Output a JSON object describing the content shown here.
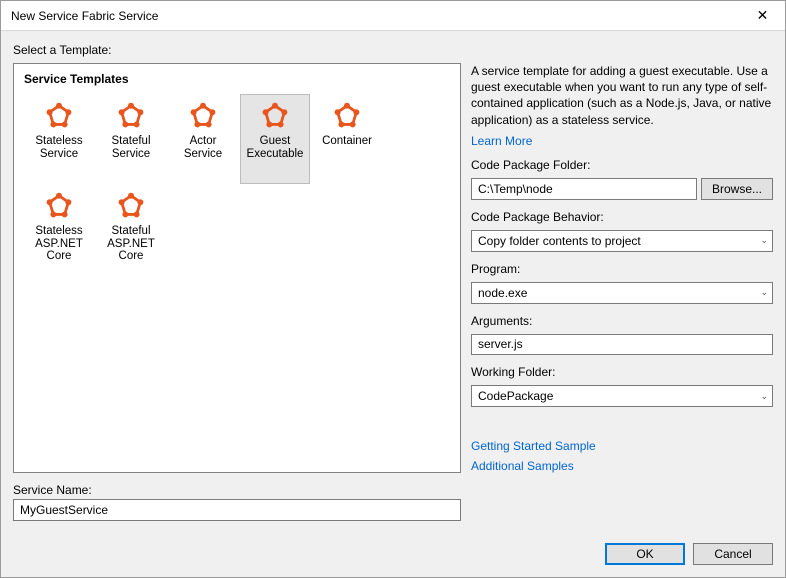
{
  "window": {
    "title": "New Service Fabric Service"
  },
  "selectTemplateLabel": "Select a Template:",
  "templatesHeading": "Service Templates",
  "templates": [
    {
      "label": "Stateless Service",
      "selected": false
    },
    {
      "label": "Stateful Service",
      "selected": false
    },
    {
      "label": "Actor Service",
      "selected": false
    },
    {
      "label": "Guest Executable",
      "selected": true
    },
    {
      "label": "Container",
      "selected": false
    },
    {
      "label": "Stateless ASP.NET Core",
      "selected": false
    },
    {
      "label": "Stateful ASP.NET Core",
      "selected": false
    }
  ],
  "details": {
    "descriptionText": "A service template for adding a guest executable. Use a guest executable when you want to run any type of self-contained application (such as a Node.js, Java, or native application) as a stateless service.",
    "learnMoreLabel": "Learn More",
    "codePackageFolderLabel": "Code Package Folder:",
    "codePackageFolderValue": "C:\\Temp\\node",
    "browseLabel": "Browse...",
    "codePackageBehaviorLabel": "Code Package Behavior:",
    "codePackageBehaviorValue": "Copy folder contents to project",
    "programLabel": "Program:",
    "programValue": "node.exe",
    "argumentsLabel": "Arguments:",
    "argumentsValue": "server.js",
    "workingFolderLabel": "Working Folder:",
    "workingFolderValue": "CodePackage",
    "gettingStartedLabel": "Getting Started Sample",
    "additionalSamplesLabel": "Additional Samples"
  },
  "serviceNameLabel": "Service Name:",
  "serviceNameValue": "MyGuestService",
  "footer": {
    "okLabel": "OK",
    "cancelLabel": "Cancel"
  }
}
